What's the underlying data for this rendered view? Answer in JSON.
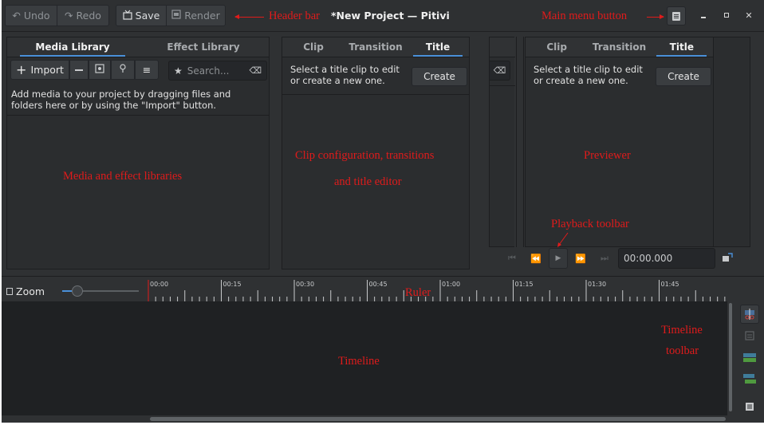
{
  "header": {
    "undo_label": "Undo",
    "redo_label": "Redo",
    "save_label": "Save",
    "render_label": "Render",
    "title": "*New Project — Pitivi"
  },
  "library": {
    "tabs": [
      "Media Library",
      "Effect Library"
    ],
    "import_label": "Import",
    "search_placeholder": "Search...",
    "hint_line1": "Add media to your project by dragging files and",
    "hint_line2": "folders here or by using the \"Import\" button."
  },
  "clip_config": {
    "tabs": [
      "Clip",
      "Transition",
      "Title"
    ],
    "hint_line1": "Select a title clip to edit",
    "hint_line2": "or create a new one.",
    "create_label": "Create"
  },
  "viewer": {
    "tabs": [
      "Clip",
      "Transition",
      "Title"
    ],
    "hint_line1": "Select a title clip to edit",
    "hint_line2": "or create a new one.",
    "create_label": "Create",
    "timecode": "00:00.000"
  },
  "ruler": {
    "zoom_label": "Zoom",
    "ticks": [
      "00:00",
      "00:15",
      "00:30",
      "00:45",
      "01:00",
      "01:15",
      "01:30",
      "01:45"
    ]
  },
  "annotations": {
    "header_bar": "Header bar",
    "main_menu": "Main menu button",
    "libraries": "Media and effect libraries",
    "clip_config_1": "Clip configuration, transitions",
    "clip_config_2": "and title editor",
    "previewer": "Previewer",
    "playback": "Playback toolbar",
    "ruler": "Ruler",
    "timeline": "Timeline",
    "timeline_toolbar_1": "Timeline",
    "timeline_toolbar_2": "toolbar"
  },
  "colors": {
    "annotation": "#e01b1b",
    "accent": "#4a90d9",
    "window_bg": "#2f3133",
    "timeline_bg": "#1f2123"
  }
}
